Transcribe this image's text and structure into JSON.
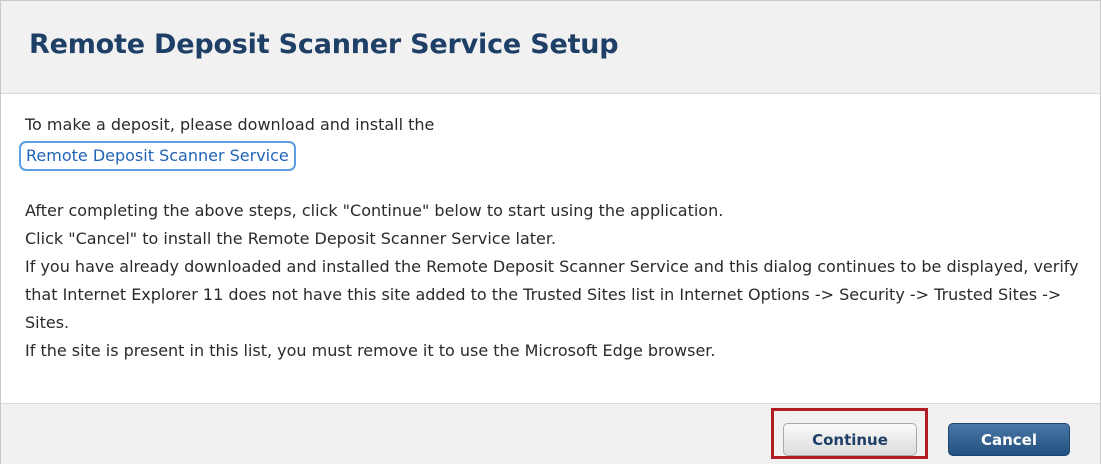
{
  "dialog": {
    "title": "Remote Deposit Scanner Service Setup",
    "intro_text": "To make a deposit, please download and install the",
    "link_text": "Remote Deposit Scanner Service",
    "paragraphs": [
      "After completing the above steps, click \"Continue\" below to start using the application.",
      "Click \"Cancel\" to install the Remote Deposit Scanner Service later.",
      "If you have already downloaded and installed the Remote Deposit Scanner Service and this dialog continues to be displayed, verify that Internet Explorer 11 does not have this site added to the Trusted Sites list in Internet Options -> Security -> Trusted Sites -> Sites.",
      "If the site is present in this list, you must remove it to use the Microsoft Edge browser."
    ]
  },
  "footer": {
    "continue_label": "Continue",
    "cancel_label": "Cancel"
  },
  "colors": {
    "title": "#1e3f66",
    "link": "#1f63b8",
    "link_focus_ring": "#5a9fe6",
    "highlight_box": "#b01e23",
    "cancel_button": "#2a5a8a"
  }
}
